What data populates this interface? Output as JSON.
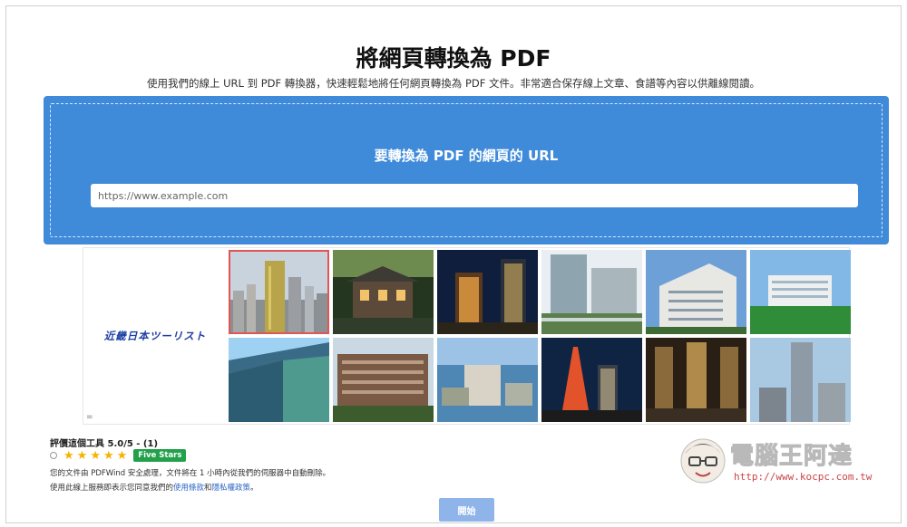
{
  "header": {
    "title": "將網頁轉換為 PDF",
    "subtitle": "使用我們的線上 URL 到 PDF 轉換器，快速輕鬆地將任何網頁轉換為 PDF 文件。非常適合保存線上文章、食譜等內容以供離線閱讀。"
  },
  "converter": {
    "heading": "要轉換為 PDF 的網頁的 URL",
    "url_value": "",
    "url_placeholder": "https://www.example.com"
  },
  "ad": {
    "brand_logo_text": "近畿日本ツーリスト",
    "menu_glyph": "=",
    "images": [
      {
        "name": "city-skyline-photo",
        "selected": true
      },
      {
        "name": "japanese-inn-photo"
      },
      {
        "name": "night-hotel-photo"
      },
      {
        "name": "glass-tower-photo"
      },
      {
        "name": "hotel-building-photo"
      },
      {
        "name": "seaside-hotel-photo"
      },
      {
        "name": "blue-tower-photo"
      },
      {
        "name": "brick-hotel-photo"
      },
      {
        "name": "harbor-aerial-photo"
      },
      {
        "name": "tokyo-tower-night-photo"
      },
      {
        "name": "hotel-lobby-photo"
      },
      {
        "name": "skyscraper-photo"
      }
    ]
  },
  "rating": {
    "label": "評價這個工具 5.0/5 - (1)",
    "stars": 5,
    "badge": "Five Stars"
  },
  "notes": {
    "security": "您的文件由 PDFWind 安全處理，文件將在 1 小時內從我們的伺服器中自動刪除。",
    "terms_prefix": "使用此線上服務即表示您同意我們的",
    "terms_link": "使用條款",
    "terms_and": "和",
    "privacy_link": "隱私權政策",
    "terms_suffix": "。"
  },
  "actions": {
    "start_label": "開始"
  },
  "watermark": {
    "title": "電腦王阿達",
    "url": "http://www.kocpc.com.tw"
  },
  "colors": {
    "dropzone": "#3f8ad9",
    "start_button": "#8fb4ea",
    "badge": "#22a04b",
    "star": "#f5b301",
    "link": "#2a64c6"
  }
}
